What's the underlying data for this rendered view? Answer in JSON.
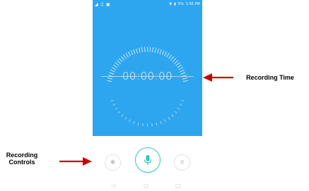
{
  "status_bar": {
    "left_icons": [
      "signal-icon",
      "music-icon",
      "image-icon"
    ],
    "right_text": "1:55 PM",
    "battery_text": "5%"
  },
  "timer": {
    "value": "00:00:00"
  },
  "annotations": {
    "recording_time": "Recording Time",
    "recording_controls_line1": "Recording",
    "recording_controls_line2": "Controls"
  },
  "controls": {
    "settings_icon": "gear-icon",
    "record_icon": "microphone-icon",
    "list_icon": "list-icon"
  },
  "nav": {
    "back_icon": "back-triangle-icon",
    "home_icon": "home-circle-icon",
    "recent_icon": "recent-square-icon"
  },
  "colors": {
    "screen_background": "#2ea6ef",
    "accent": "#2cc9b8",
    "arrow": "#cc0000"
  }
}
